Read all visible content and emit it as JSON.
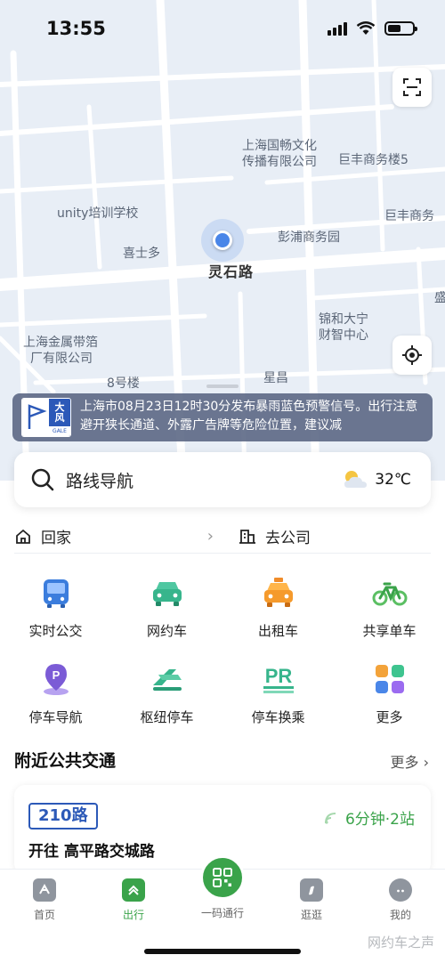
{
  "status_bar": {
    "time": "13:55"
  },
  "map": {
    "labels": {
      "company1_line1": "上海国畅文化",
      "company1_line2": "传播有限公司",
      "jufeng1": "巨丰商务楼5",
      "jufeng2": "巨丰商务",
      "unity": "unity培训学校",
      "pengpu": "彭浦商务园",
      "xishiduo": "喜士多",
      "road": "灵石路",
      "jinhe_line1": "锦和大宁",
      "jinhe_line2": "财智中心",
      "jinshu_line1": "上海金属带箔",
      "jinshu_line2": "厂有限公司",
      "bahao": "8号楼",
      "xingchang": "星昌",
      "sheng": "盛"
    }
  },
  "warning": {
    "badge_top": "大",
    "badge_bottom": "风",
    "badge_small": "GALE",
    "text": "上海市08月23日12时30分发布暴雨蓝色预警信号。出行注意避开狭长通道、外露广告牌等危险位置，建议减"
  },
  "search": {
    "label": "路线导航"
  },
  "weather": {
    "temp": "32℃"
  },
  "quick": {
    "home": "回家",
    "company": "去公司"
  },
  "services": [
    {
      "label": "实时公交",
      "icon": "bus-icon"
    },
    {
      "label": "网约车",
      "icon": "car-icon"
    },
    {
      "label": "出租车",
      "icon": "taxi-icon"
    },
    {
      "label": "共享单车",
      "icon": "bike-icon"
    },
    {
      "label": "停车导航",
      "icon": "parking-pin-icon"
    },
    {
      "label": "枢纽停车",
      "icon": "hub-parking-icon"
    },
    {
      "label": "停车换乘",
      "icon": "park-ride-icon"
    },
    {
      "label": "更多",
      "icon": "grid-more-icon"
    }
  ],
  "nearby": {
    "title": "附近公共交通",
    "more": "更多",
    "route": "210路",
    "eta": "6分钟·2站",
    "destination": "开往 高平路交城路"
  },
  "tabs": [
    {
      "label": "首页"
    },
    {
      "label": "出行"
    },
    {
      "label": "一码通行"
    },
    {
      "label": "逛逛"
    },
    {
      "label": "我的"
    }
  ],
  "watermark": "网约车之声",
  "colors": {
    "accent_green": "#3aa34a",
    "route_blue": "#2c59b8",
    "map_bg": "#e8eef6"
  }
}
